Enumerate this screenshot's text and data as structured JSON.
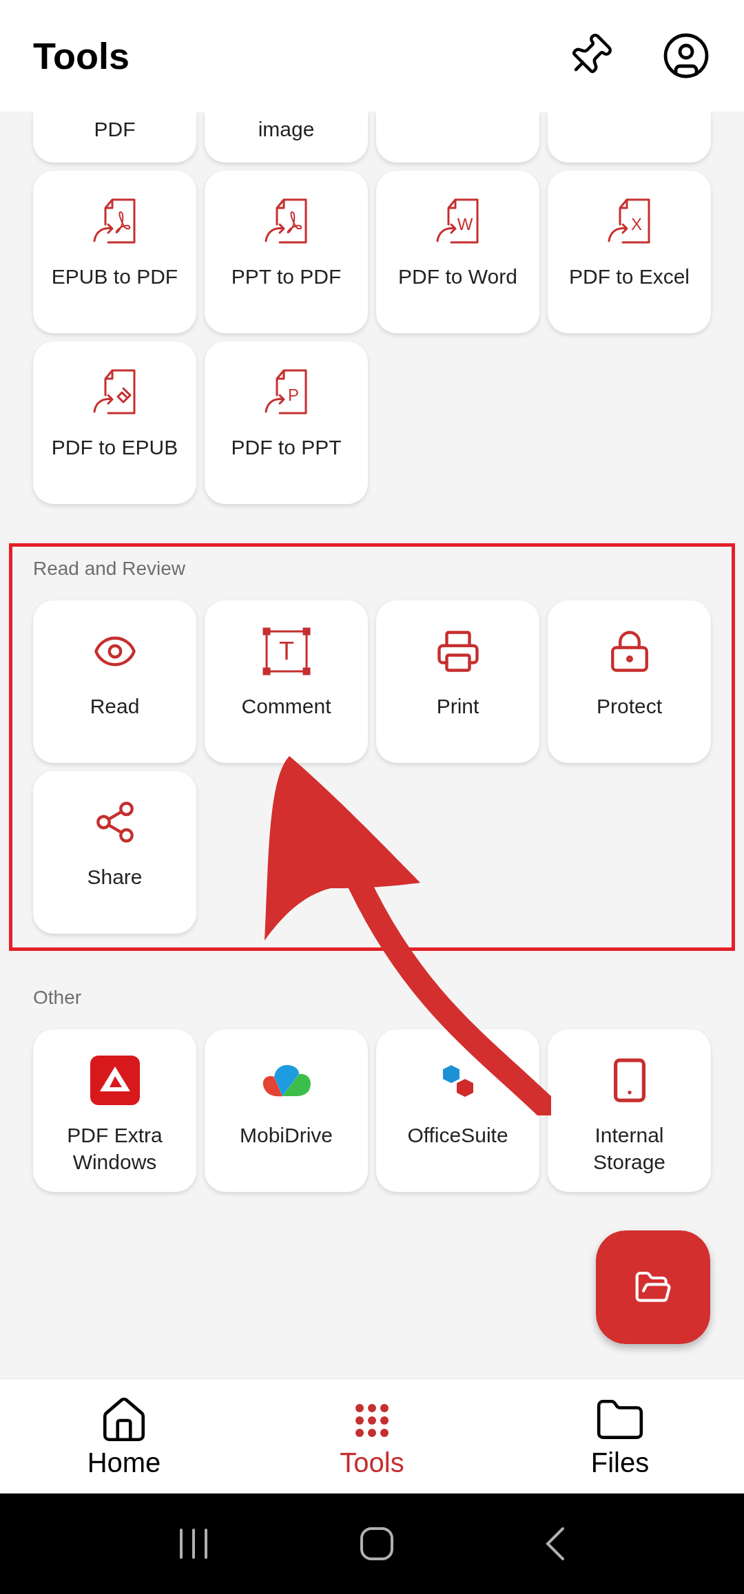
{
  "header": {
    "title": "Tools"
  },
  "partial_row": [
    {
      "kind": "label",
      "label": "PDF"
    },
    {
      "kind": "label",
      "label": "image"
    },
    {
      "kind": "blank"
    },
    {
      "kind": "blank"
    }
  ],
  "convert_tools": [
    {
      "label": "EPUB to PDF",
      "kind": "pdf"
    },
    {
      "label": "PPT to PDF",
      "kind": "pdf"
    },
    {
      "label": "PDF to Word",
      "kind": "letter",
      "glyph": "W"
    },
    {
      "label": "PDF to Excel",
      "kind": "letter",
      "glyph": "X"
    },
    {
      "label": "PDF to EPUB",
      "kind": "epub"
    },
    {
      "label": "PDF to PPT",
      "kind": "letter",
      "glyph": "P"
    }
  ],
  "read_review": {
    "title": "Read and Review",
    "highlighted": true,
    "tools": [
      {
        "label": "Read",
        "kind": "eye"
      },
      {
        "label": "Comment",
        "kind": "textbox",
        "glyph": "T"
      },
      {
        "label": "Print",
        "kind": "printer"
      },
      {
        "label": "Protect",
        "kind": "lock"
      },
      {
        "label": "Share",
        "kind": "share"
      }
    ]
  },
  "other": {
    "title": "Other",
    "tools": [
      {
        "label": "PDF Extra Windows",
        "kind": "pdfextra"
      },
      {
        "label": "MobiDrive",
        "kind": "cloud"
      },
      {
        "label": "OfficeSuite",
        "kind": "cubes"
      },
      {
        "label": "Internal Storage",
        "kind": "phone"
      }
    ]
  },
  "bottom_nav": [
    {
      "label": "Home",
      "kind": "home",
      "selected": false
    },
    {
      "label": "Tools",
      "kind": "dots",
      "selected": true
    },
    {
      "label": "Files",
      "kind": "folder",
      "selected": false
    }
  ]
}
